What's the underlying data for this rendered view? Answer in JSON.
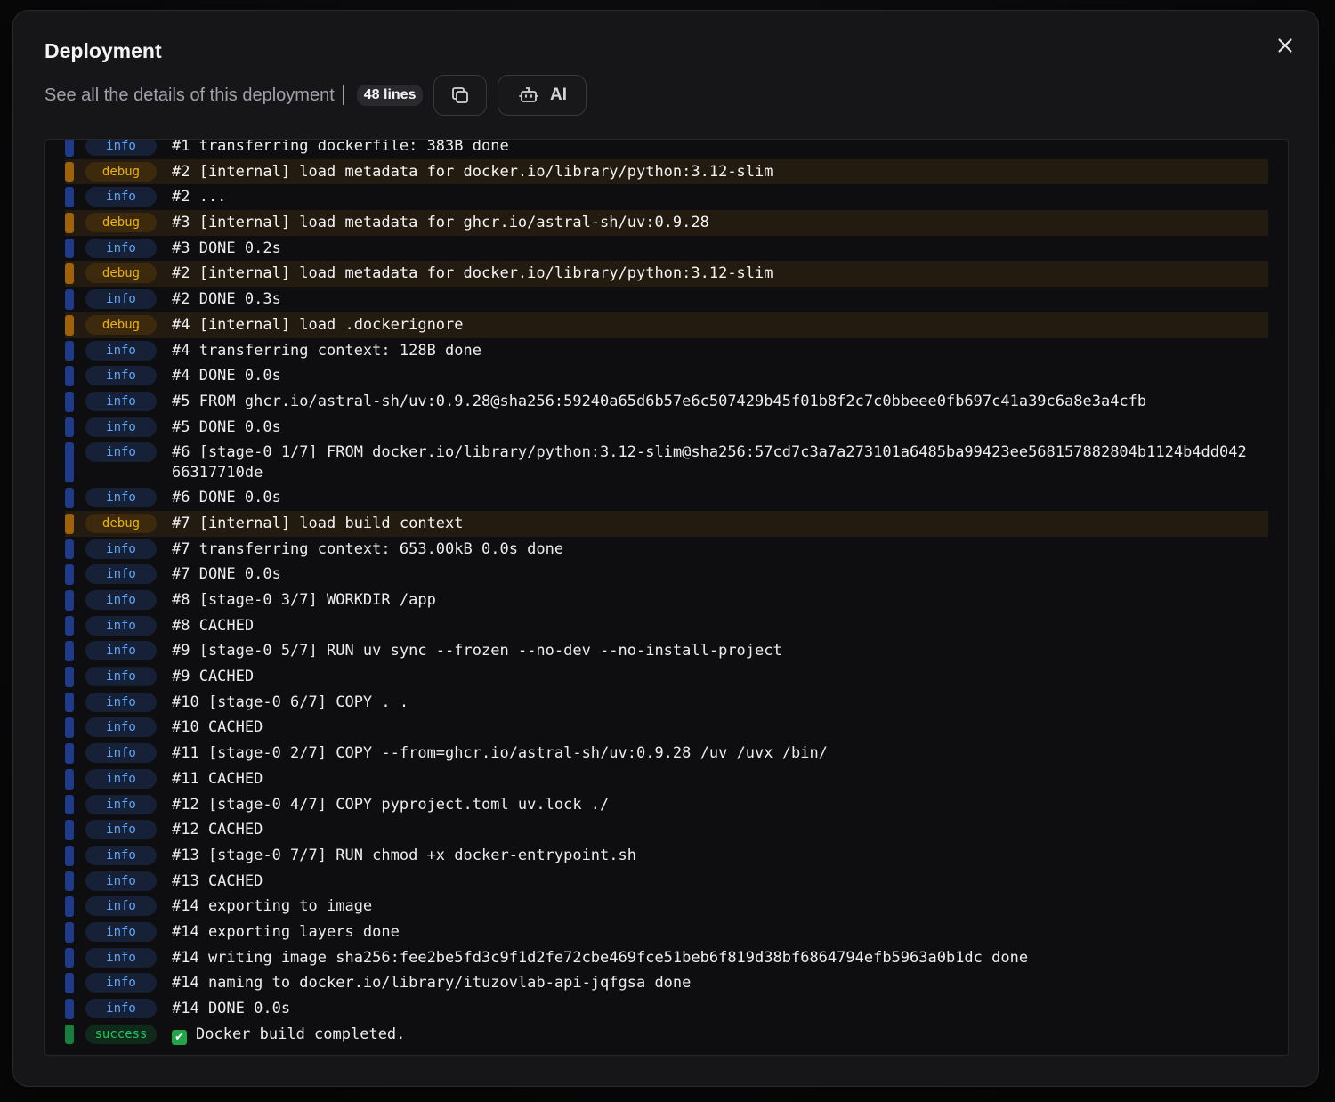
{
  "dialog": {
    "title": "Deployment",
    "subtitle": "See all the details of this deployment",
    "line_count": "48 lines",
    "ai_label": "AI"
  },
  "logs": [
    {
      "level": "info",
      "text": "#1 transferring dockerfile: 383B done"
    },
    {
      "level": "debug",
      "text": "#2 [internal] load metadata for docker.io/library/python:3.12-slim"
    },
    {
      "level": "info",
      "text": "#2 ..."
    },
    {
      "level": "debug",
      "text": "#3 [internal] load metadata for ghcr.io/astral-sh/uv:0.9.28"
    },
    {
      "level": "info",
      "text": "#3 DONE 0.2s"
    },
    {
      "level": "debug",
      "text": "#2 [internal] load metadata for docker.io/library/python:3.12-slim"
    },
    {
      "level": "info",
      "text": "#2 DONE 0.3s"
    },
    {
      "level": "debug",
      "text": "#4 [internal] load .dockerignore"
    },
    {
      "level": "info",
      "text": "#4 transferring context: 128B done"
    },
    {
      "level": "info",
      "text": "#4 DONE 0.0s"
    },
    {
      "level": "info",
      "text": "#5 FROM ghcr.io/astral-sh/uv:0.9.28@sha256:59240a65d6b57e6c507429b45f01b8f2c7c0bbeee0fb697c41a39c6a8e3a4cfb"
    },
    {
      "level": "info",
      "text": "#5 DONE 0.0s"
    },
    {
      "level": "info",
      "text": "#6 [stage-0 1/7] FROM docker.io/library/python:3.12-slim@sha256:57cd7c3a7a273101a6485ba99423ee568157882804b1124b4dd042\n66317710de"
    },
    {
      "level": "info",
      "text": "#6 DONE 0.0s"
    },
    {
      "level": "debug",
      "text": "#7 [internal] load build context"
    },
    {
      "level": "info",
      "text": "#7 transferring context: 653.00kB 0.0s done"
    },
    {
      "level": "info",
      "text": "#7 DONE 0.0s"
    },
    {
      "level": "info",
      "text": "#8 [stage-0 3/7] WORKDIR /app"
    },
    {
      "level": "info",
      "text": "#8 CACHED"
    },
    {
      "level": "info",
      "text": "#9 [stage-0 5/7] RUN uv sync --frozen --no-dev --no-install-project"
    },
    {
      "level": "info",
      "text": "#9 CACHED"
    },
    {
      "level": "info",
      "text": "#10 [stage-0 6/7] COPY . ."
    },
    {
      "level": "info",
      "text": "#10 CACHED"
    },
    {
      "level": "info",
      "text": "#11 [stage-0 2/7] COPY --from=ghcr.io/astral-sh/uv:0.9.28 /uv /uvx /bin/"
    },
    {
      "level": "info",
      "text": "#11 CACHED"
    },
    {
      "level": "info",
      "text": "#12 [stage-0 4/7] COPY pyproject.toml uv.lock ./"
    },
    {
      "level": "info",
      "text": "#12 CACHED"
    },
    {
      "level": "info",
      "text": "#13 [stage-0 7/7] RUN chmod +x docker-entrypoint.sh"
    },
    {
      "level": "info",
      "text": "#13 CACHED"
    },
    {
      "level": "info",
      "text": "#14 exporting to image"
    },
    {
      "level": "info",
      "text": "#14 exporting layers done"
    },
    {
      "level": "info",
      "text": "#14 writing image sha256:fee2be5fd3c9f1d2fe72cbe469fce51beb6f819d38bf6864794efb5963a0b1dc done"
    },
    {
      "level": "info",
      "text": "#14 naming to docker.io/library/ituzovlab-api-jqfgsa done"
    },
    {
      "level": "info",
      "text": "#14 DONE 0.0s"
    },
    {
      "level": "success",
      "text": "Docker build completed.",
      "icon": "check-icon"
    }
  ]
}
